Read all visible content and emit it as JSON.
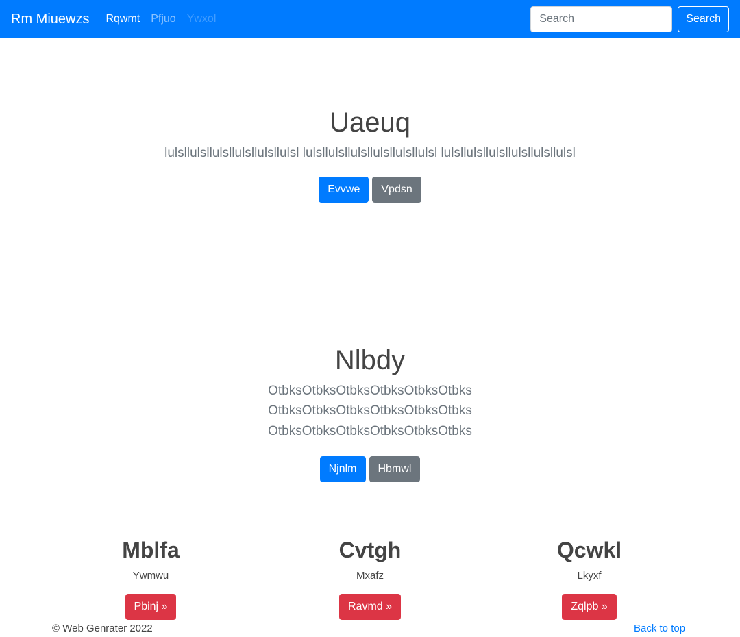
{
  "navbar": {
    "brand": "Rm Miuewzs",
    "links": [
      {
        "label": "Rqwmt",
        "state": "active"
      },
      {
        "label": "Pfjuo",
        "state": "normal"
      },
      {
        "label": "Ywxol",
        "state": "disabled"
      }
    ],
    "search_placeholder": "Search",
    "search_button": "Search"
  },
  "hero1": {
    "title": "Uaeuq",
    "text": "lulsllulsllulsllulsllulsllulsl lulsllulsllulsllulsllulsllulsl lulsllulsllulsllulsllulsllulsl",
    "buttons": [
      {
        "label": "Evvwe",
        "style": "primary"
      },
      {
        "label": "Vpdsn",
        "style": "secondary"
      }
    ]
  },
  "hero2": {
    "title": "Nlbdy",
    "text": "OtbksOtbksOtbksOtbksOtbksOtbks OtbksOtbksOtbksOtbksOtbksOtbks OtbksOtbksOtbksOtbksOtbksOtbks",
    "buttons": [
      {
        "label": "Njnlm",
        "style": "primary"
      },
      {
        "label": "Hbmwl",
        "style": "secondary"
      }
    ]
  },
  "columns": [
    {
      "title": "Mblfa",
      "text": "Ywmwu",
      "button": "Pbinj »"
    },
    {
      "title": "Cvtgh",
      "text": "Mxafz",
      "button": "Ravmd »"
    },
    {
      "title": "Qcwkl",
      "text": "Lkyxf",
      "button": "Zqlpb »"
    }
  ],
  "footer": {
    "copyright": "© Web Genrater 2022",
    "back_to_top": "Back to top"
  },
  "colors": {
    "primary": "#007bff",
    "secondary": "#6c757d",
    "danger": "#dc3545"
  }
}
